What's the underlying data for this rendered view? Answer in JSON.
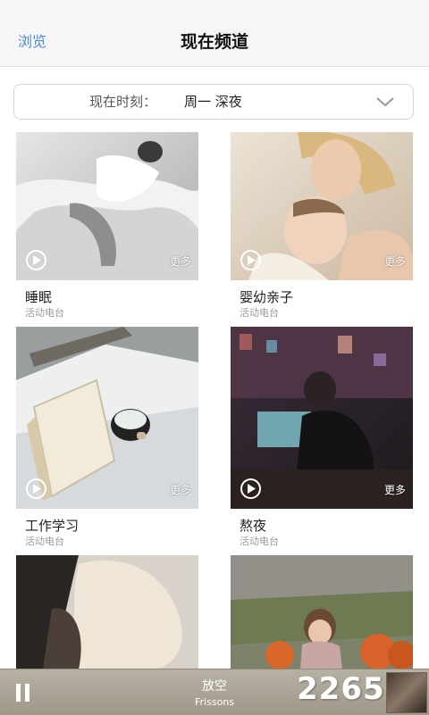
{
  "nav": {
    "back_label": "浏览",
    "title": "现在频道"
  },
  "time_selector": {
    "label": "现在时刻：",
    "value": "周一 深夜"
  },
  "channels": [
    {
      "title": "睡眠",
      "subtitle": "活动电台",
      "more": "更多"
    },
    {
      "title": "婴幼亲子",
      "subtitle": "活动电台",
      "more": "更多"
    },
    {
      "title": "工作学习",
      "subtitle": "活动电台",
      "more": "更多"
    },
    {
      "title": "熬夜",
      "subtitle": "活动电台",
      "more": "更多"
    }
  ],
  "player": {
    "track": "放空",
    "artist": "Frissons"
  },
  "watermark": "2265",
  "colors": {
    "accent": "#4b8bd0",
    "player_bg": "#a9a294"
  }
}
